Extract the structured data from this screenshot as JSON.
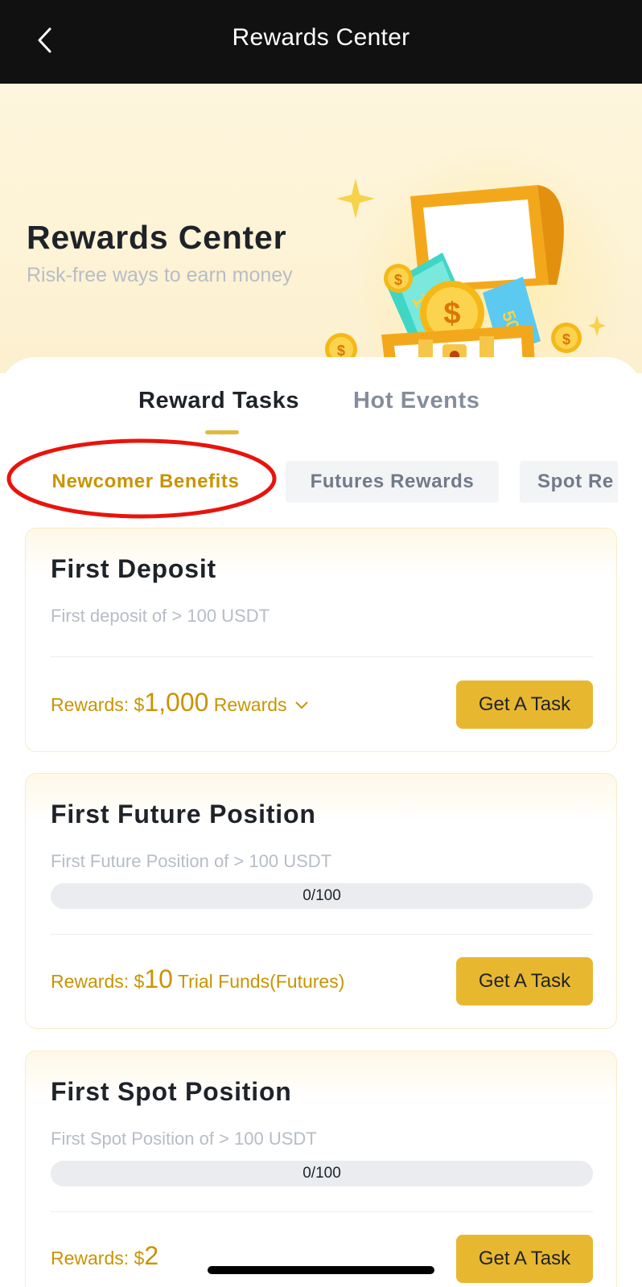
{
  "topbar": {
    "title": "Rewards Center"
  },
  "hero": {
    "title": "Rewards Center",
    "subtitle": "Risk-free ways to earn money"
  },
  "main_tabs": [
    {
      "label": "Reward Tasks",
      "active": true
    },
    {
      "label": "Hot Events",
      "active": false
    }
  ],
  "category_chips": [
    {
      "label": "Newcomer Benefits",
      "active": true
    },
    {
      "label": "Futures Rewards",
      "active": false
    },
    {
      "label": "Spot Re",
      "active": false
    }
  ],
  "tasks": [
    {
      "title": "First Deposit",
      "description": "First deposit of > 100 USDT",
      "reward_prefix": "Rewards: $",
      "reward_amount": "1,000",
      "reward_suffix": " Rewards",
      "button_label": "Get A Task"
    },
    {
      "title": "First Future Position",
      "description": "First Future Position of > 100 USDT",
      "progress_text": "0/100",
      "progress_fraction": 0,
      "reward_prefix": "Rewards: $",
      "reward_amount": "10",
      "reward_suffix": " Trial Funds(Futures)",
      "button_label": "Get A Task"
    },
    {
      "title": "First Spot Position",
      "description": "First Spot Position of > 100 USDT",
      "progress_text": "0/100",
      "progress_fraction": 0,
      "reward_prefix": "Rewards: $",
      "reward_amount": "2",
      "reward_suffix": "",
      "button_label": "Get A Task"
    }
  ],
  "colors": {
    "accent": "#e8b730",
    "accent_text": "#c99400",
    "annotation": "#e8140c",
    "topbar_bg": "#111111"
  },
  "icons": [
    "back-arrow-icon",
    "chevron-down-icon",
    "treasure-chest-illustration"
  ]
}
